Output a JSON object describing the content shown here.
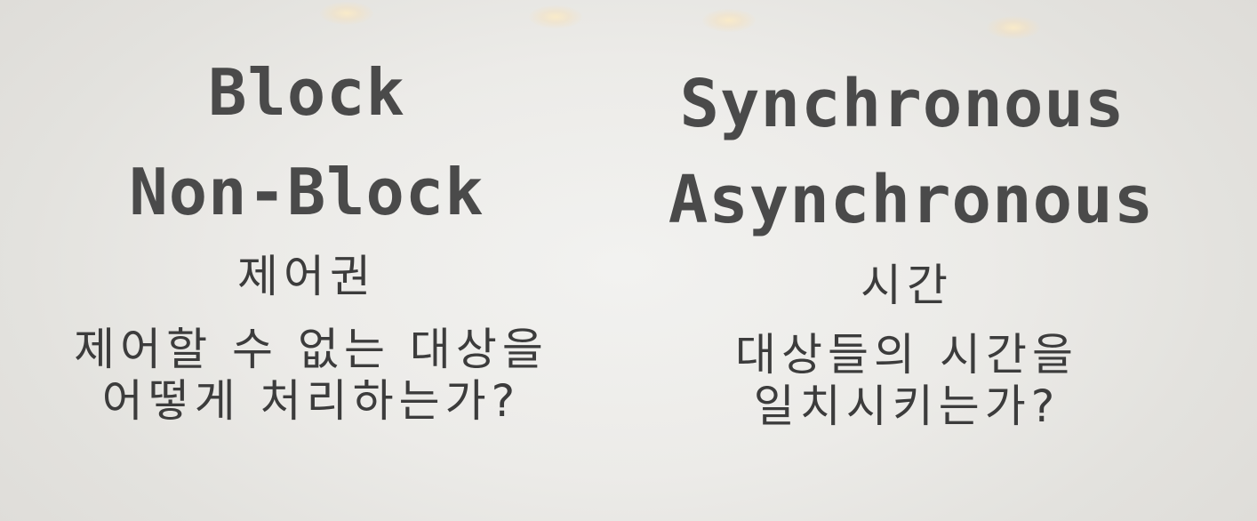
{
  "left": {
    "term_1": "Block",
    "term_2": "Non-Block",
    "keyword": "제어권",
    "question_line_1": "제어할 수 없는 대상을",
    "question_line_2": "어떻게 처리하는가?"
  },
  "right": {
    "term_1": "Synchronous",
    "term_2": "Asynchronous",
    "keyword": "시간",
    "question_line_1": "대상들의 시간을",
    "question_line_2": "일치시키는가?"
  }
}
